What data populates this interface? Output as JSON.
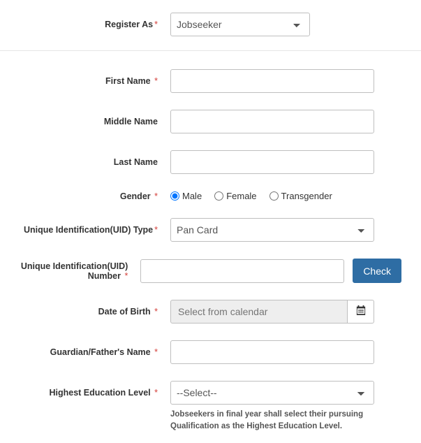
{
  "registerAs": {
    "label": "Register As",
    "required": true,
    "value": "Jobseeker"
  },
  "firstName": {
    "label": "First Name",
    "required": true,
    "value": ""
  },
  "middleName": {
    "label": "Middle Name",
    "required": false,
    "value": ""
  },
  "lastName": {
    "label": "Last Name",
    "required": false,
    "value": ""
  },
  "gender": {
    "label": "Gender",
    "required": true,
    "options": [
      "Male",
      "Female",
      "Transgender"
    ],
    "value": "Male"
  },
  "uidType": {
    "label": "Unique Identification(UID) Type",
    "required": true,
    "value": "Pan Card"
  },
  "uidNumber": {
    "label": "Unique Identification(UID) Number",
    "required": true,
    "value": "",
    "checkLabel": "Check"
  },
  "dob": {
    "label": "Date of Birth",
    "required": true,
    "placeholder": "Select from calendar",
    "value": ""
  },
  "guardian": {
    "label": "Guardian/Father's Name",
    "required": true,
    "value": ""
  },
  "education": {
    "label": "Highest Education Level",
    "required": true,
    "value": "--Select--",
    "note": "Jobseekers in final year shall select their pursuing Qualification as the Highest Education Level."
  }
}
